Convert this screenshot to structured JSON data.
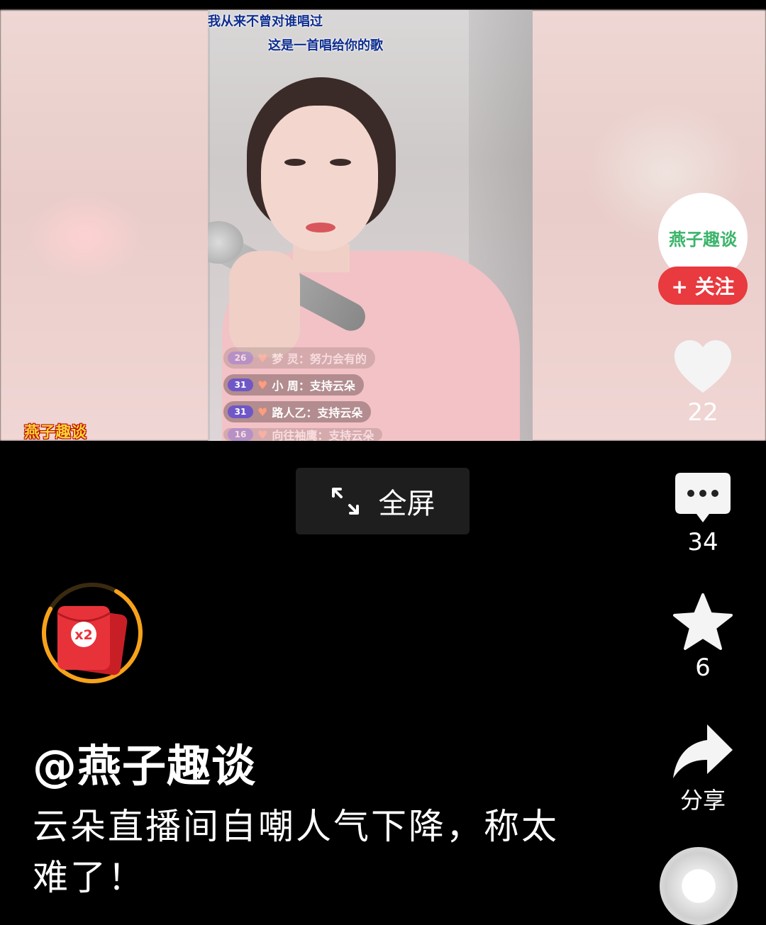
{
  "video": {
    "lyrics": [
      "我从来不曾对谁唱过",
      "这是一首唱给你的歌"
    ],
    "comments": [
      {
        "level": "26",
        "text": "梦 灵：努力会有的"
      },
      {
        "level": "31",
        "text": "小 周：支持云朵"
      },
      {
        "level": "31",
        "text": "路人乙：支持云朵"
      },
      {
        "level": "16",
        "text": "向往袖鹰：支持云朵"
      }
    ],
    "watermark": "燕子趣谈"
  },
  "fullscreen": {
    "label": "全屏"
  },
  "red_packet": {
    "multiplier": "x2",
    "progress": 0.75
  },
  "post": {
    "author": "@燕子趣谈",
    "caption": "云朵直播间自嘲人气下降，称太难了！"
  },
  "sidebar": {
    "avatar_text": "燕子趣谈",
    "follow_label": "+ 关注",
    "likes": "22",
    "comments": "34",
    "favorites": "6",
    "share_label": "分享"
  },
  "colors": {
    "follow": "#e83a3f",
    "red_packet": "#e8323a",
    "progress_ring": "#f7a21b"
  }
}
